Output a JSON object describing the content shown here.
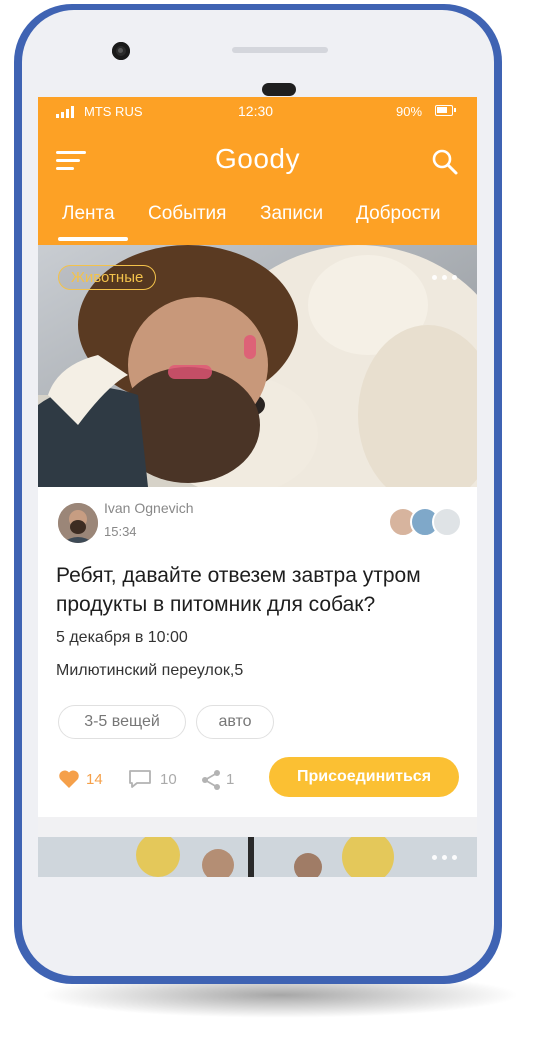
{
  "status_bar": {
    "carrier": "MTS RUS",
    "time": "12:30",
    "battery": "90%"
  },
  "header": {
    "title": "Goody",
    "menu_icon": "hamburger-menu-icon",
    "search_icon": "search-icon"
  },
  "tabs": [
    {
      "label": "Лента",
      "active": true
    },
    {
      "label": "События",
      "active": false
    },
    {
      "label": "Записи",
      "active": false
    },
    {
      "label": "Доброcти",
      "active": false
    }
  ],
  "post": {
    "category": "Животные",
    "author": "Ivan Ognevich",
    "time": "15:34",
    "headline": "Ребят, давайте отвезем завтра утром продукты в питомник для собак?",
    "date": "5 декабря в 10:00",
    "address": "Милютинский переулок,5",
    "tags": [
      "3-5 вещей",
      "авто"
    ],
    "likes": "14",
    "comments": "10",
    "shares": "1",
    "join_label": "Присоединиться"
  },
  "colors": {
    "header_orange": "#fda125",
    "accent_yellow": "#fbc033",
    "like_orange": "#f5a04a",
    "phone_frame": "#3f63b3"
  }
}
